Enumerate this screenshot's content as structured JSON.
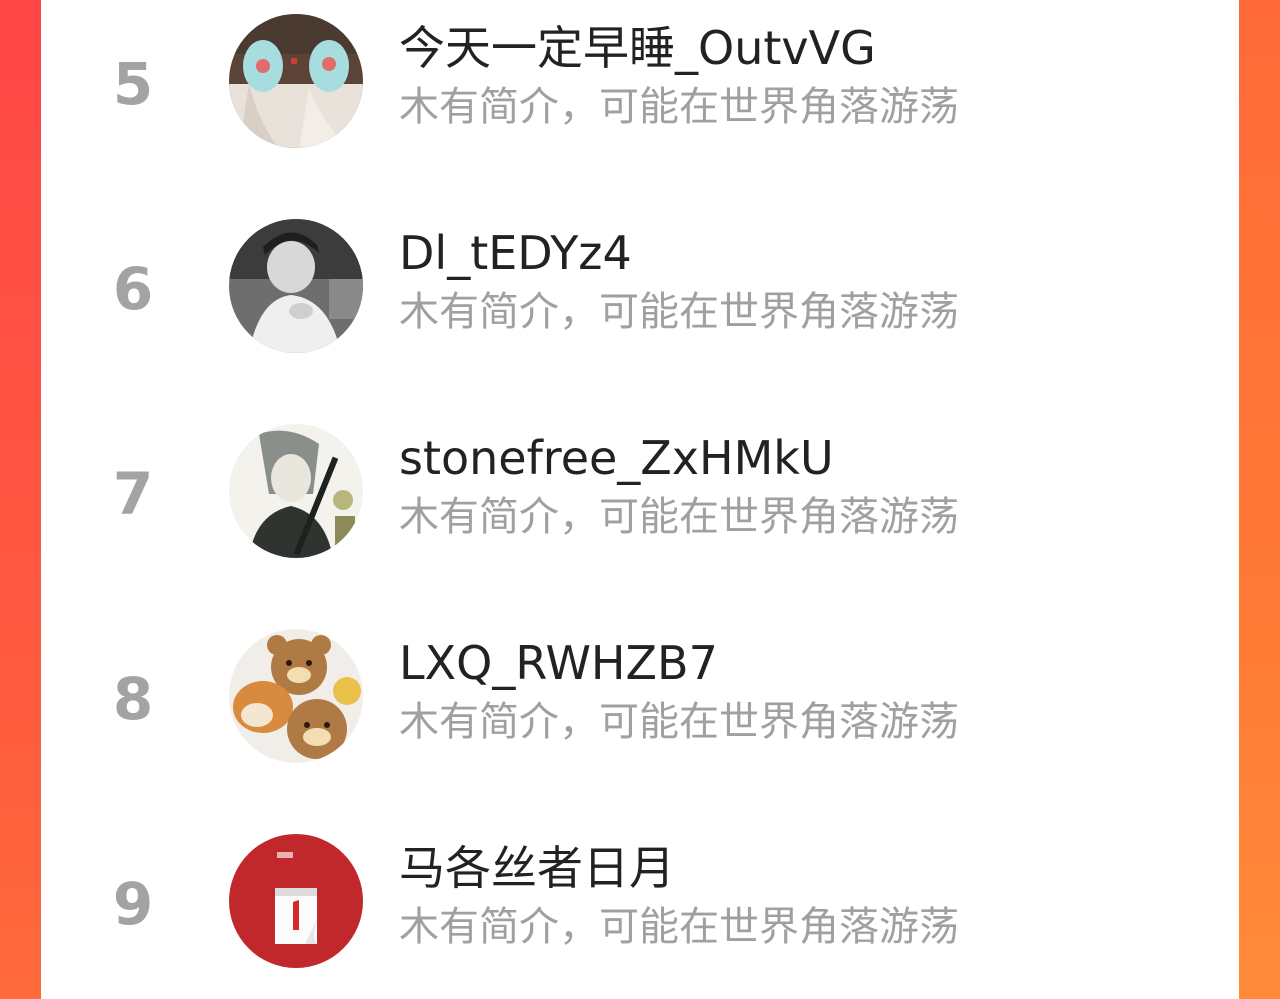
{
  "colors": {
    "accent_left": "#ff4a3d",
    "accent_right": "#ff7a36",
    "rank_gray": "#a3a3a3",
    "name_text": "#222222",
    "desc_text": "#a0a0a0"
  },
  "ranking": {
    "items": [
      {
        "rank": "5",
        "name": "今天一定早睡_OutvVG",
        "bio": "木有简介，可能在世界角落游荡",
        "avatar": "slippers-photo-avatar"
      },
      {
        "rank": "6",
        "name": "Dl_tEDYz4",
        "bio": "木有简介，可能在世界角落游荡",
        "avatar": "bw-portrait-avatar"
      },
      {
        "rank": "7",
        "name": "stonefree_ZxHMkU",
        "bio": "木有简介，可能在世界角落游荡",
        "avatar": "anime-character-avatar"
      },
      {
        "rank": "8",
        "name": "LXQ_RWHZB7",
        "bio": "木有简介，可能在世界角落游荡",
        "avatar": "bears-and-shiba-avatar"
      },
      {
        "rank": "9",
        "name": "马各丝者日月",
        "bio": "木有简介，可能在世界角落游荡",
        "avatar": "red-calendar-avatar"
      }
    ]
  }
}
